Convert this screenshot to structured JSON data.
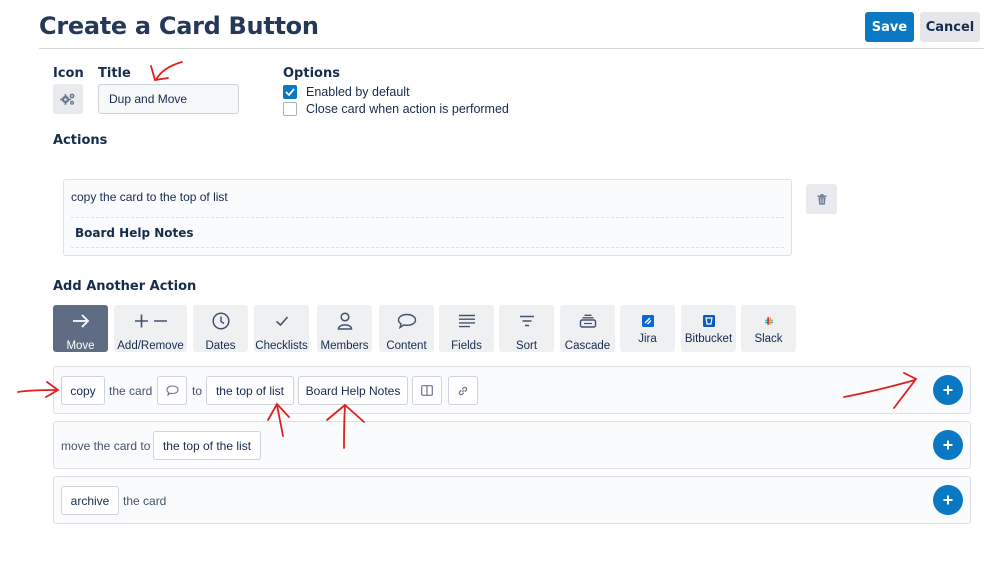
{
  "header": {
    "title": "Create a Card Button",
    "save_label": "Save",
    "cancel_label": "Cancel"
  },
  "form": {
    "icon_label": "Icon",
    "icon_value": "gears-icon",
    "title_label": "Title",
    "title_value": "Dup and Move",
    "options_label": "Options",
    "options": [
      {
        "label": "Enabled by default",
        "checked": true
      },
      {
        "label": "Close card when action is performed",
        "checked": false
      }
    ]
  },
  "actions": {
    "heading": "Actions",
    "items": [
      {
        "line1": "copy the card to the top of list",
        "line2": "Board Help Notes"
      }
    ]
  },
  "add_action": {
    "heading": "Add Another Action",
    "tabs": [
      {
        "label": "Move",
        "icon": "arrow-right-icon",
        "active": true
      },
      {
        "label": "Add/Remove",
        "icon": "plus-minus-icon",
        "active": false
      },
      {
        "label": "Dates",
        "icon": "clock-icon",
        "active": false
      },
      {
        "label": "Checklists",
        "icon": "checkmark-icon",
        "active": false
      },
      {
        "label": "Members",
        "icon": "person-icon",
        "active": false
      },
      {
        "label": "Content",
        "icon": "speech-bubble-icon",
        "active": false
      },
      {
        "label": "Fields",
        "icon": "lines-icon",
        "active": false
      },
      {
        "label": "Sort",
        "icon": "filter-icon",
        "active": false
      },
      {
        "label": "Cascade",
        "icon": "stack-icon",
        "active": false
      },
      {
        "label": "Jira",
        "icon": "jira-icon",
        "active": false
      },
      {
        "label": "Bitbucket",
        "icon": "bitbucket-icon",
        "active": false
      },
      {
        "label": "Slack",
        "icon": "slack-icon",
        "active": false
      }
    ]
  },
  "rows": [
    {
      "verb": "copy",
      "text1": "the card",
      "text2": "to",
      "position": "the top of list",
      "list": "Board Help Notes"
    },
    {
      "text1": "move the card to",
      "position": "the top of the list"
    },
    {
      "verb": "archive",
      "text1": "the card"
    }
  ],
  "colors": {
    "primary": "#0a78c2",
    "title": "#253858",
    "active_tab": "#5e6c84",
    "annotation": "#e0201e"
  }
}
